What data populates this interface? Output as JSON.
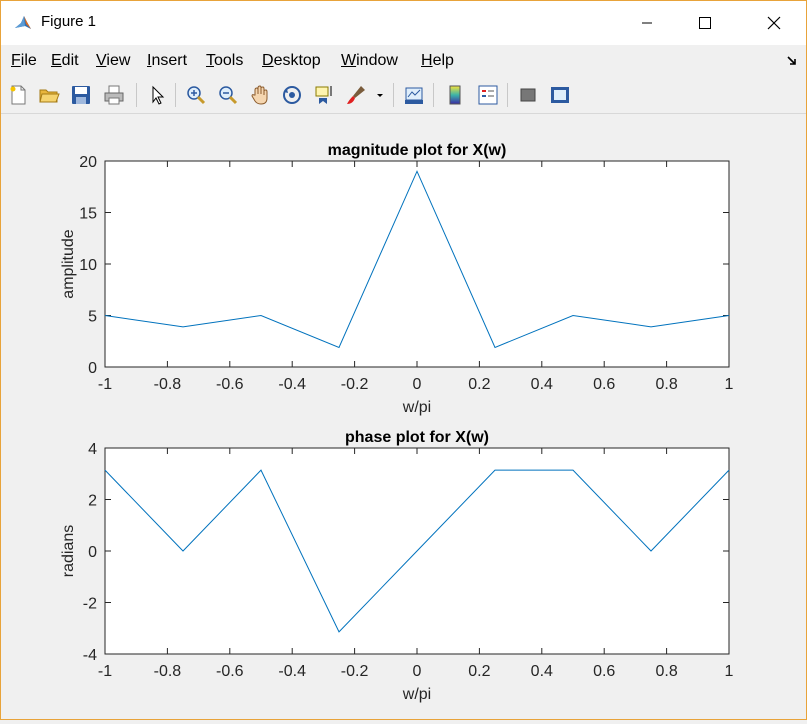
{
  "window": {
    "title": "Figure 1",
    "buttons": {
      "minimize": "minimize-icon",
      "maximize": "maximize-icon",
      "close": "close-icon"
    }
  },
  "menu": {
    "items": [
      {
        "label": "File",
        "mnemonic": "F"
      },
      {
        "label": "Edit",
        "mnemonic": "E"
      },
      {
        "label": "View",
        "mnemonic": "V"
      },
      {
        "label": "Insert",
        "mnemonic": "I"
      },
      {
        "label": "Tools",
        "mnemonic": "T"
      },
      {
        "label": "Desktop",
        "mnemonic": "D"
      },
      {
        "label": "Window",
        "mnemonic": "W"
      },
      {
        "label": "Help",
        "mnemonic": "H"
      }
    ]
  },
  "toolbar": {
    "icons": [
      "new-figure-icon",
      "open-file-icon",
      "save-icon",
      "print-icon",
      "pointer-icon",
      "zoom-in-icon",
      "zoom-out-icon",
      "pan-hand-icon",
      "rotate-3d-icon",
      "data-cursor-icon",
      "brush-icon",
      "brush-dropdown-icon",
      "link-plot-icon",
      "colorbar-icon",
      "legend-icon",
      "hide-plot-tools-icon",
      "show-plot-tools-icon"
    ]
  },
  "colors": {
    "line": "#0072bd",
    "axes_bg": "#ffffff",
    "figure_bg": "#f0f0f0",
    "window_border": "#e8a33a"
  },
  "chart_data": [
    {
      "type": "line",
      "title": "magnitude plot for X(w)",
      "xlabel": "w/pi",
      "ylabel": "amplitude",
      "xlim": [
        -1,
        1
      ],
      "ylim": [
        0,
        20
      ],
      "xticks": [
        -1,
        -0.8,
        -0.6,
        -0.4,
        -0.2,
        0,
        0.2,
        0.4,
        0.6,
        0.8,
        1
      ],
      "xtick_labels": [
        "-1",
        "-0.8",
        "-0.6",
        "-0.4",
        "-0.2",
        "0",
        "0.2",
        "0.4",
        "0.6",
        "0.8",
        "1"
      ],
      "yticks": [
        0,
        5,
        10,
        15,
        20
      ],
      "ytick_labels": [
        "0",
        "5",
        "10",
        "15",
        "20"
      ],
      "grid": false,
      "series": [
        {
          "x": [
            -1,
            -0.75,
            -0.5,
            -0.25,
            0,
            0.25,
            0.5,
            0.75,
            1
          ],
          "y": [
            5,
            3.9,
            5,
            1.9,
            19,
            1.9,
            5,
            3.9,
            5
          ]
        }
      ]
    },
    {
      "type": "line",
      "title": "phase plot for X(w)",
      "xlabel": "w/pi",
      "ylabel": "radians",
      "xlim": [
        -1,
        1
      ],
      "ylim": [
        -4,
        4
      ],
      "xticks": [
        -1,
        -0.8,
        -0.6,
        -0.4,
        -0.2,
        0,
        0.2,
        0.4,
        0.6,
        0.8,
        1
      ],
      "xtick_labels": [
        "-1",
        "-0.8",
        "-0.6",
        "-0.4",
        "-0.2",
        "0",
        "0.2",
        "0.4",
        "0.6",
        "0.8",
        "1"
      ],
      "yticks": [
        -4,
        -2,
        0,
        2,
        4
      ],
      "ytick_labels": [
        "-4",
        "-2",
        "0",
        "2",
        "4"
      ],
      "grid": false,
      "series": [
        {
          "x": [
            -1,
            -0.75,
            -0.5,
            -0.25,
            0,
            0.25,
            0.5,
            0.75,
            1
          ],
          "y": [
            3.14,
            0,
            3.14,
            -3.14,
            0,
            3.14,
            3.14,
            0,
            3.14
          ]
        }
      ]
    }
  ]
}
